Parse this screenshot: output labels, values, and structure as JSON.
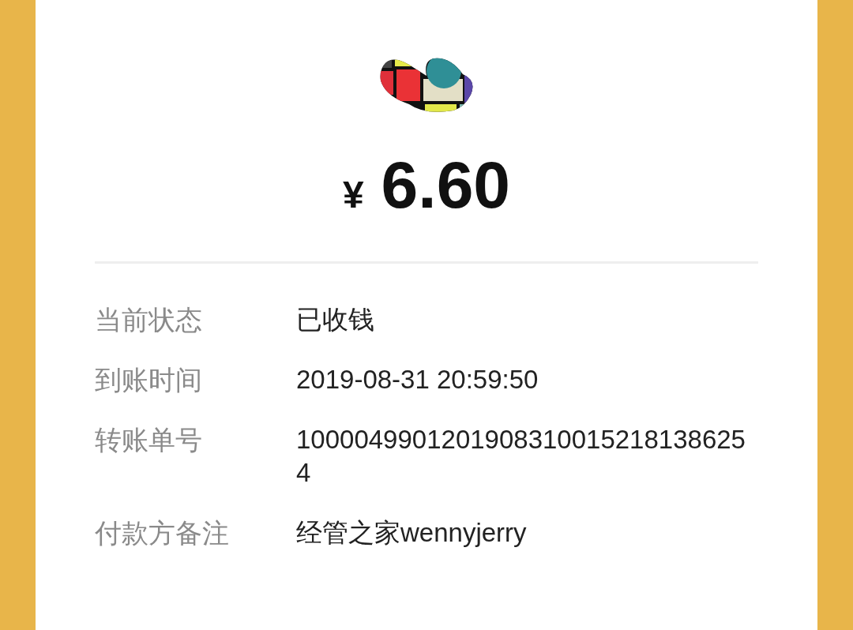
{
  "amount": {
    "currency": "¥",
    "value": "6.60"
  },
  "details": [
    {
      "label": "当前状态",
      "value": "已收钱"
    },
    {
      "label": "到账时间",
      "value": "2019-08-31 20:59:50"
    },
    {
      "label": "转账单号",
      "value": "10000499012019083100152181386254"
    },
    {
      "label": "付款方备注",
      "value": "经管之家wennyjerry"
    }
  ]
}
